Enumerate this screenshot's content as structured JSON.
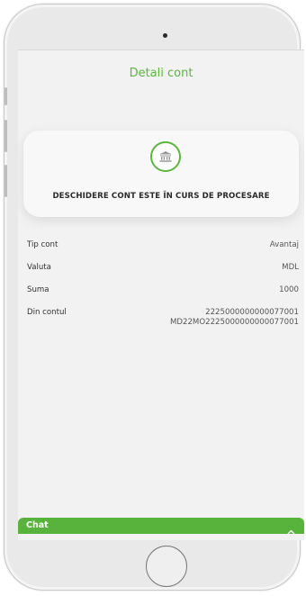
{
  "header": {
    "title": "Detali cont"
  },
  "status": {
    "icon": "bank-icon",
    "message": "DESCHIDERE CONT ESTE ÎN CURS DE PROCESARE"
  },
  "details": [
    {
      "label": "Tip cont",
      "value": "Avantaj"
    },
    {
      "label": "Valuta",
      "value": "MDL"
    },
    {
      "label": "Suma",
      "value": "1000"
    },
    {
      "label": "Din contul",
      "value": "2225000000000077001",
      "value2": "MD22MO2225000000000077001"
    }
  ],
  "chat": {
    "label": "Chat",
    "icon": "chevron-up-icon"
  },
  "colors": {
    "accent": "#5bb53f",
    "chat_bar": "#57b33c"
  }
}
